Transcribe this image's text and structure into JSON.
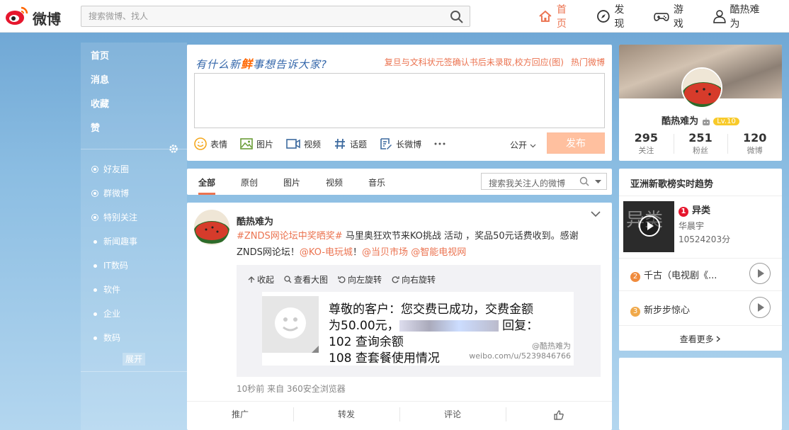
{
  "topbar": {
    "logo_text": "微博",
    "search_placeholder": "搜索微博、找人",
    "nav": [
      {
        "label": "首页",
        "icon": "home-icon"
      },
      {
        "label": "发现",
        "icon": "compass-icon"
      },
      {
        "label": "游戏",
        "icon": "gamepad-icon"
      },
      {
        "label": "酷热难为",
        "icon": "user-icon"
      }
    ],
    "accent_color": "#eb7350"
  },
  "leftnav": {
    "main": [
      "首页",
      "消息",
      "收藏",
      "赞"
    ],
    "groups": [
      "好友圈",
      "群微博",
      "特别关注",
      "新闻趣事",
      "IT数码",
      "软件",
      "企业",
      "数码"
    ],
    "expand_label": "展开"
  },
  "publisher": {
    "prompt_pre": "有什么新",
    "prompt_emph": "鲜",
    "prompt_post": "事想告诉大家?",
    "hot_topic": "复旦与文科状元签确认书后未录取,校方回应(图)",
    "hot_label": "热门微博",
    "tools": [
      "表情",
      "图片",
      "视频",
      "话题",
      "长微博"
    ],
    "visibility": "公开",
    "send_label": "发布"
  },
  "tabs": {
    "items": [
      "全部",
      "原创",
      "图片",
      "视频",
      "音乐"
    ],
    "search_placeholder": "搜索我关注人的微博"
  },
  "feed": {
    "user": "酷热难为",
    "hashtag": "#ZNDS网论坛中奖晒奖#",
    "text1": " 马里奥狂欢节来KO挑战 活动 ，奖品50元话费收到。感谢ZNDS网论坛！",
    "mention1": "@KO-电玩城",
    "sep": "！",
    "mention2": "@当贝市场",
    "mention3": "@智能电视网",
    "media_tools": [
      "收起",
      "查看大图",
      "向左旋转",
      "向右旋转"
    ],
    "image_lines": [
      "尊敬的客户：您交费已成功，交费金额",
      "为50.00元，",
      "回复：",
      "102 查询余额",
      "108 查套餐使用情况"
    ],
    "watermark_user": "@酷热难为",
    "watermark_url": "weibo.com/u/5239846766",
    "meta": "10秒前 来自 360安全浏览器",
    "actions": [
      "推广",
      "转发",
      "评论"
    ]
  },
  "profile": {
    "name": "酷热难为",
    "level": "Lv.10",
    "stats": [
      {
        "n": "295",
        "l": "关注"
      },
      {
        "n": "251",
        "l": "粉丝"
      },
      {
        "n": "120",
        "l": "微博"
      }
    ]
  },
  "music": {
    "title": "亚洲新歌榜实时趋势",
    "top": {
      "rank": "1",
      "song": "异类",
      "artist": "华晨宇",
      "score": "10524203分",
      "cover_text": "异类"
    },
    "rows": [
      {
        "rank": "2",
        "song": "千古（电视剧《..."
      },
      {
        "rank": "3",
        "song": "新步步惊心"
      }
    ],
    "more": "查看更多"
  }
}
